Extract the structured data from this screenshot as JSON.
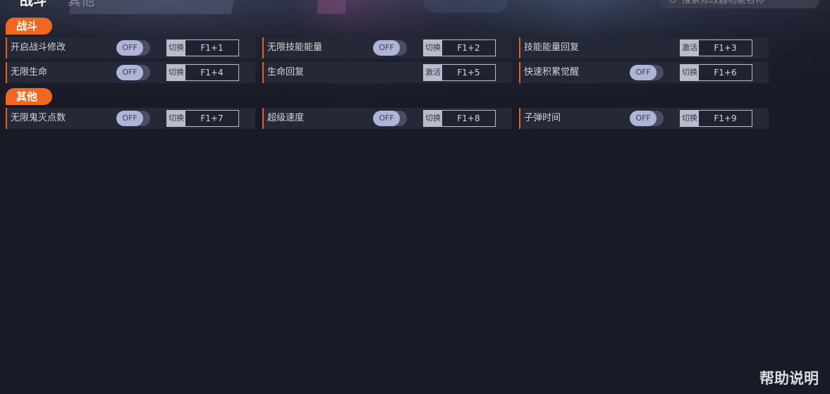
{
  "top_tabs": [
    {
      "label": "战斗"
    },
    {
      "label": "其他"
    }
  ],
  "search": {
    "placeholder": "搜索修改器功能名称"
  },
  "sections": [
    {
      "title": "战斗",
      "rows": [
        [
          {
            "label": "开启战斗修改",
            "toggle": "OFF",
            "action": "切换",
            "hotkey": "F1+1"
          },
          {
            "label": "无限技能能量",
            "toggle": "OFF",
            "action": "切换",
            "hotkey": "F1+2"
          },
          {
            "label": "技能能量回复",
            "toggle": null,
            "action": "激活",
            "hotkey": "F1+3"
          }
        ],
        [
          {
            "label": "无限生命",
            "toggle": "OFF",
            "action": "切换",
            "hotkey": "F1+4"
          },
          {
            "label": "生命回复",
            "toggle": null,
            "action": "激活",
            "hotkey": "F1+5"
          },
          {
            "label": "快速积累觉醒",
            "toggle": "OFF",
            "action": "切换",
            "hotkey": "F1+6"
          }
        ]
      ]
    },
    {
      "title": "其他",
      "rows": [
        [
          {
            "label": "无限鬼灭点数",
            "toggle": "OFF",
            "action": "切换",
            "hotkey": "F1+7"
          },
          {
            "label": "超级速度",
            "toggle": "OFF",
            "action": "切换",
            "hotkey": "F1+8"
          },
          {
            "label": "子弹时间",
            "toggle": "OFF",
            "action": "切换",
            "hotkey": "F1+9"
          }
        ]
      ]
    }
  ],
  "help_label": "帮助说明",
  "colors": {
    "accent": "#f0671d",
    "background": "#181b26",
    "cell": "#252836",
    "toggle_knob": "#b0b5d8"
  }
}
